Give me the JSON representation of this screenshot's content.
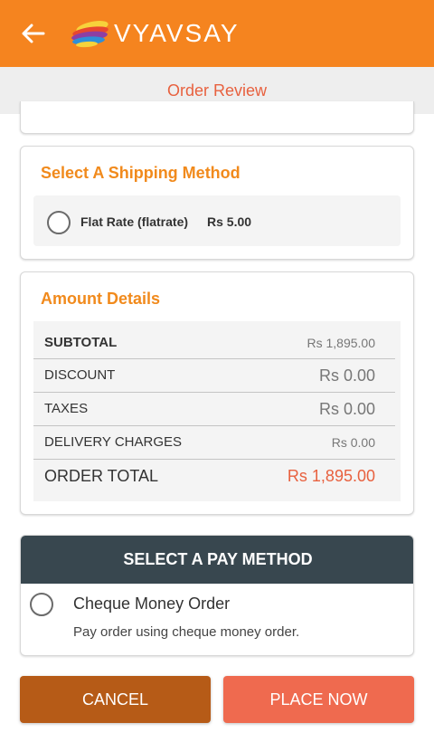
{
  "header": {
    "brand": "VYAVSAY",
    "bar_color": "#f5841f",
    "back_icon": "arrow-left-icon",
    "logo_icon": "vyavsay-logo-icon"
  },
  "subheader": {
    "title": "Order Review"
  },
  "shipping": {
    "title": "Select A Shipping Method",
    "option": {
      "name": "Flat Rate (flatrate)",
      "price": "Rs 5.00",
      "selected": false
    }
  },
  "amount": {
    "title": "Amount Details",
    "rows": [
      {
        "label": "SUBTOTAL",
        "value": "Rs 1,895.00"
      },
      {
        "label": "DISCOUNT",
        "value": "Rs 0.00"
      },
      {
        "label": "TAXES",
        "value": "Rs 0.00"
      },
      {
        "label": "DELIVERY CHARGES",
        "value": "Rs 0.00"
      },
      {
        "label": "ORDER TOTAL",
        "value": "Rs 1,895.00"
      }
    ]
  },
  "payment": {
    "header": "SELECT A PAY METHOD",
    "option": {
      "name": "Cheque Money Order",
      "description": "Pay order using cheque money order.",
      "selected": false
    }
  },
  "actions": {
    "cancel": "CANCEL",
    "place": "PLACE NOW"
  },
  "colors": {
    "accent": "#f18a1c",
    "total": "#e8613f",
    "cancel": "#b65b17",
    "place": "#ef6a4f",
    "pay_header": "#38474f"
  }
}
